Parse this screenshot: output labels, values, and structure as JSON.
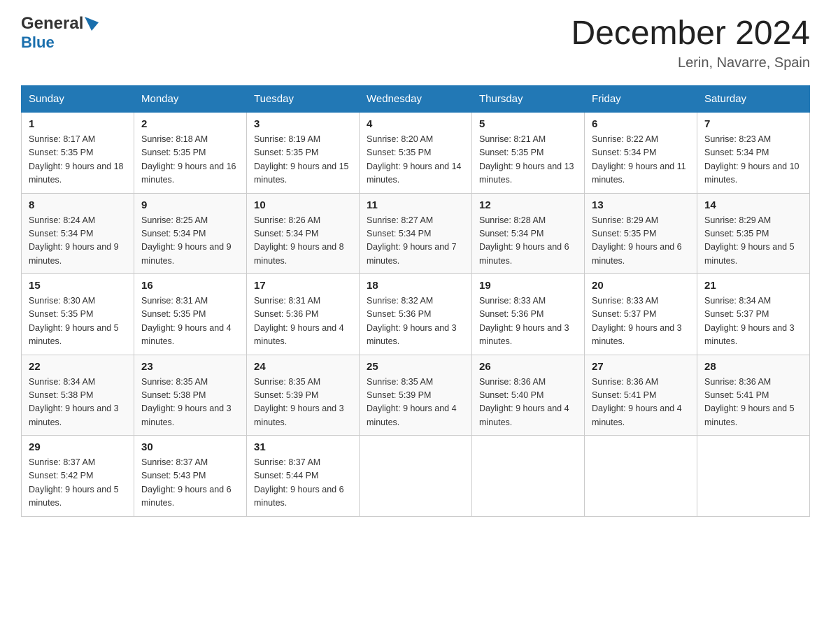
{
  "header": {
    "logo_general": "General",
    "logo_blue": "Blue",
    "month_title": "December 2024",
    "location": "Lerin, Navarre, Spain"
  },
  "days_of_week": [
    "Sunday",
    "Monday",
    "Tuesday",
    "Wednesday",
    "Thursday",
    "Friday",
    "Saturday"
  ],
  "weeks": [
    [
      {
        "day": "1",
        "sunrise": "Sunrise: 8:17 AM",
        "sunset": "Sunset: 5:35 PM",
        "daylight": "Daylight: 9 hours and 18 minutes."
      },
      {
        "day": "2",
        "sunrise": "Sunrise: 8:18 AM",
        "sunset": "Sunset: 5:35 PM",
        "daylight": "Daylight: 9 hours and 16 minutes."
      },
      {
        "day": "3",
        "sunrise": "Sunrise: 8:19 AM",
        "sunset": "Sunset: 5:35 PM",
        "daylight": "Daylight: 9 hours and 15 minutes."
      },
      {
        "day": "4",
        "sunrise": "Sunrise: 8:20 AM",
        "sunset": "Sunset: 5:35 PM",
        "daylight": "Daylight: 9 hours and 14 minutes."
      },
      {
        "day": "5",
        "sunrise": "Sunrise: 8:21 AM",
        "sunset": "Sunset: 5:35 PM",
        "daylight": "Daylight: 9 hours and 13 minutes."
      },
      {
        "day": "6",
        "sunrise": "Sunrise: 8:22 AM",
        "sunset": "Sunset: 5:34 PM",
        "daylight": "Daylight: 9 hours and 11 minutes."
      },
      {
        "day": "7",
        "sunrise": "Sunrise: 8:23 AM",
        "sunset": "Sunset: 5:34 PM",
        "daylight": "Daylight: 9 hours and 10 minutes."
      }
    ],
    [
      {
        "day": "8",
        "sunrise": "Sunrise: 8:24 AM",
        "sunset": "Sunset: 5:34 PM",
        "daylight": "Daylight: 9 hours and 9 minutes."
      },
      {
        "day": "9",
        "sunrise": "Sunrise: 8:25 AM",
        "sunset": "Sunset: 5:34 PM",
        "daylight": "Daylight: 9 hours and 9 minutes."
      },
      {
        "day": "10",
        "sunrise": "Sunrise: 8:26 AM",
        "sunset": "Sunset: 5:34 PM",
        "daylight": "Daylight: 9 hours and 8 minutes."
      },
      {
        "day": "11",
        "sunrise": "Sunrise: 8:27 AM",
        "sunset": "Sunset: 5:34 PM",
        "daylight": "Daylight: 9 hours and 7 minutes."
      },
      {
        "day": "12",
        "sunrise": "Sunrise: 8:28 AM",
        "sunset": "Sunset: 5:34 PM",
        "daylight": "Daylight: 9 hours and 6 minutes."
      },
      {
        "day": "13",
        "sunrise": "Sunrise: 8:29 AM",
        "sunset": "Sunset: 5:35 PM",
        "daylight": "Daylight: 9 hours and 6 minutes."
      },
      {
        "day": "14",
        "sunrise": "Sunrise: 8:29 AM",
        "sunset": "Sunset: 5:35 PM",
        "daylight": "Daylight: 9 hours and 5 minutes."
      }
    ],
    [
      {
        "day": "15",
        "sunrise": "Sunrise: 8:30 AM",
        "sunset": "Sunset: 5:35 PM",
        "daylight": "Daylight: 9 hours and 5 minutes."
      },
      {
        "day": "16",
        "sunrise": "Sunrise: 8:31 AM",
        "sunset": "Sunset: 5:35 PM",
        "daylight": "Daylight: 9 hours and 4 minutes."
      },
      {
        "day": "17",
        "sunrise": "Sunrise: 8:31 AM",
        "sunset": "Sunset: 5:36 PM",
        "daylight": "Daylight: 9 hours and 4 minutes."
      },
      {
        "day": "18",
        "sunrise": "Sunrise: 8:32 AM",
        "sunset": "Sunset: 5:36 PM",
        "daylight": "Daylight: 9 hours and 3 minutes."
      },
      {
        "day": "19",
        "sunrise": "Sunrise: 8:33 AM",
        "sunset": "Sunset: 5:36 PM",
        "daylight": "Daylight: 9 hours and 3 minutes."
      },
      {
        "day": "20",
        "sunrise": "Sunrise: 8:33 AM",
        "sunset": "Sunset: 5:37 PM",
        "daylight": "Daylight: 9 hours and 3 minutes."
      },
      {
        "day": "21",
        "sunrise": "Sunrise: 8:34 AM",
        "sunset": "Sunset: 5:37 PM",
        "daylight": "Daylight: 9 hours and 3 minutes."
      }
    ],
    [
      {
        "day": "22",
        "sunrise": "Sunrise: 8:34 AM",
        "sunset": "Sunset: 5:38 PM",
        "daylight": "Daylight: 9 hours and 3 minutes."
      },
      {
        "day": "23",
        "sunrise": "Sunrise: 8:35 AM",
        "sunset": "Sunset: 5:38 PM",
        "daylight": "Daylight: 9 hours and 3 minutes."
      },
      {
        "day": "24",
        "sunrise": "Sunrise: 8:35 AM",
        "sunset": "Sunset: 5:39 PM",
        "daylight": "Daylight: 9 hours and 3 minutes."
      },
      {
        "day": "25",
        "sunrise": "Sunrise: 8:35 AM",
        "sunset": "Sunset: 5:39 PM",
        "daylight": "Daylight: 9 hours and 4 minutes."
      },
      {
        "day": "26",
        "sunrise": "Sunrise: 8:36 AM",
        "sunset": "Sunset: 5:40 PM",
        "daylight": "Daylight: 9 hours and 4 minutes."
      },
      {
        "day": "27",
        "sunrise": "Sunrise: 8:36 AM",
        "sunset": "Sunset: 5:41 PM",
        "daylight": "Daylight: 9 hours and 4 minutes."
      },
      {
        "day": "28",
        "sunrise": "Sunrise: 8:36 AM",
        "sunset": "Sunset: 5:41 PM",
        "daylight": "Daylight: 9 hours and 5 minutes."
      }
    ],
    [
      {
        "day": "29",
        "sunrise": "Sunrise: 8:37 AM",
        "sunset": "Sunset: 5:42 PM",
        "daylight": "Daylight: 9 hours and 5 minutes."
      },
      {
        "day": "30",
        "sunrise": "Sunrise: 8:37 AM",
        "sunset": "Sunset: 5:43 PM",
        "daylight": "Daylight: 9 hours and 6 minutes."
      },
      {
        "day": "31",
        "sunrise": "Sunrise: 8:37 AM",
        "sunset": "Sunset: 5:44 PM",
        "daylight": "Daylight: 9 hours and 6 minutes."
      },
      {
        "day": "",
        "sunrise": "",
        "sunset": "",
        "daylight": ""
      },
      {
        "day": "",
        "sunrise": "",
        "sunset": "",
        "daylight": ""
      },
      {
        "day": "",
        "sunrise": "",
        "sunset": "",
        "daylight": ""
      },
      {
        "day": "",
        "sunrise": "",
        "sunset": "",
        "daylight": ""
      }
    ]
  ]
}
